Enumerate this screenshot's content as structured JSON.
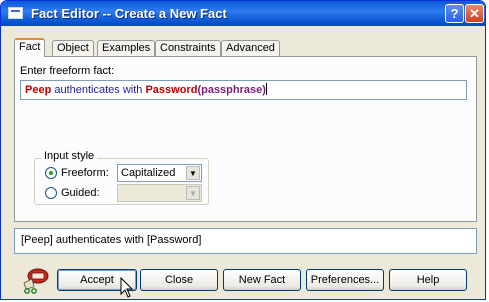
{
  "window": {
    "title": "Fact Editor -- Create a New Fact"
  },
  "tabs": [
    "Fact",
    "Object",
    "Examples",
    "Constraints",
    "Advanced"
  ],
  "fact": {
    "label": "Enter freeform fact:",
    "parts": [
      {
        "text": "Peep",
        "style": "entity"
      },
      {
        "text": " authenticates with ",
        "style": "plain"
      },
      {
        "text": "Password",
        "style": "entity"
      },
      {
        "text": "(passphrase)",
        "style": "passphrase"
      }
    ]
  },
  "input_style": {
    "label": "Input style",
    "freeform_label": "Freeform:",
    "guided_label": "Guided:",
    "selected": "freeform",
    "freeform_value": "Capitalized",
    "guided_value": ""
  },
  "preview": {
    "text": "[Peep] authenticates with [Password]"
  },
  "buttons": {
    "accept": "Accept",
    "close": "Close",
    "new_fact": "New Fact",
    "preferences": "Preferences...",
    "help": "Help"
  },
  "colors": {
    "entity": "#c00000",
    "plain": "#1f1f9f",
    "passphrase": "#7a1f7a",
    "titlebar": "#0a5ad8"
  }
}
